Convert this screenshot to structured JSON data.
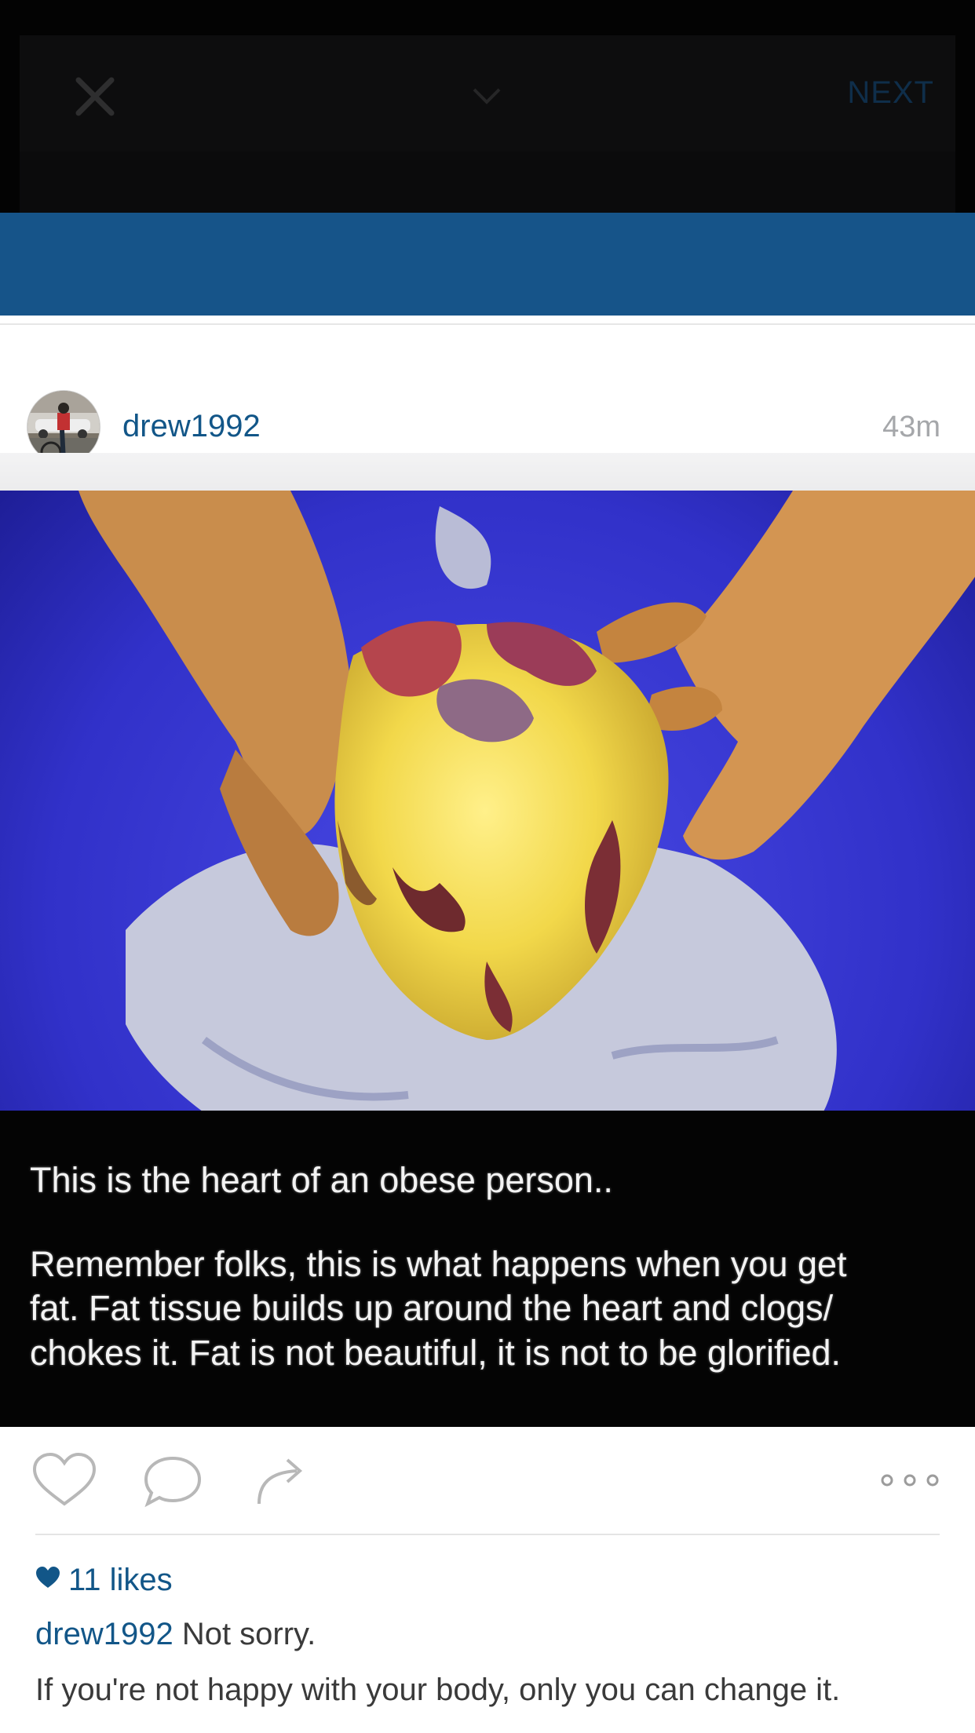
{
  "topbar": {
    "next_label": "NEXT",
    "close_icon": "close-icon",
    "chevron_icon": "chevron-down-icon"
  },
  "post": {
    "username": "drew1992",
    "timestamp": "43m",
    "photo": {
      "caption_line1": "This is the heart of an obese person..",
      "caption_line2": "Remember folks, this is what happens when you get",
      "caption_line3": "fat. Fat tissue builds up around the heart and clogs/",
      "caption_line4": "chokes it. Fat is not beautiful, it is not to be glorified."
    },
    "actions": {
      "like_icon": "heart-outline-icon",
      "comment_icon": "comment-bubble-icon",
      "share_icon": "share-arrow-icon",
      "more_icon": "more-dots-icon"
    },
    "likes_label": "11 likes",
    "caption": {
      "user": "drew1992",
      "text": "Not sorry.",
      "line2": "If you're not happy with your body, only you can change it."
    }
  },
  "colors": {
    "link_blue": "#125688",
    "brand_band": "#165489",
    "top_bar": "#030303"
  }
}
